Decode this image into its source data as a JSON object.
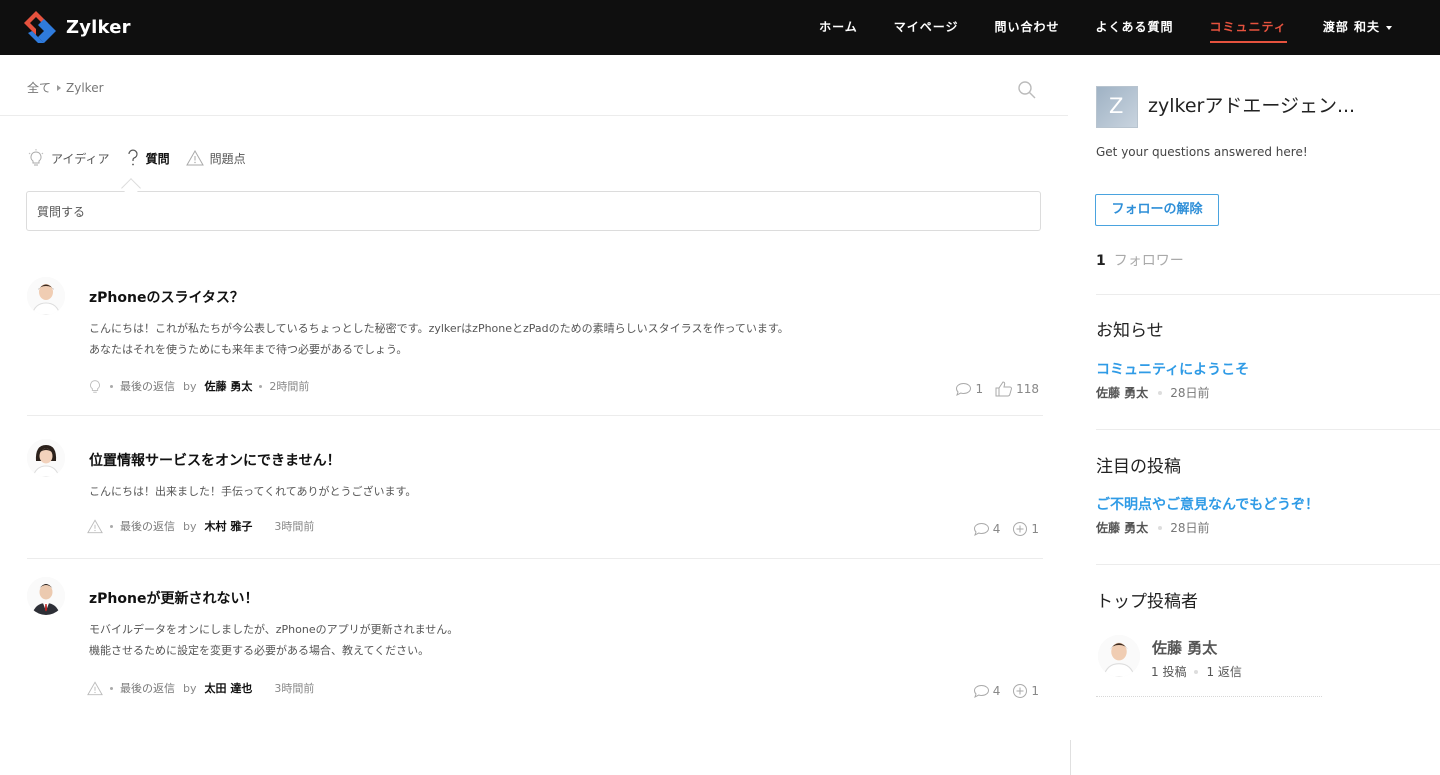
{
  "nav": {
    "brand": "Zylker",
    "items": [
      {
        "label": "ホーム",
        "active": false
      },
      {
        "label": "マイページ",
        "active": false
      },
      {
        "label": "問い合わせ",
        "active": false
      },
      {
        "label": "よくある質問",
        "active": false
      },
      {
        "label": "コミュニティ",
        "active": true
      },
      {
        "label": "渡部 和夫",
        "active": false,
        "dropdown": true
      }
    ],
    "accent_color": "#e5523e"
  },
  "breadcrumb": {
    "root": "全て",
    "current": "Zylker"
  },
  "tabs": [
    {
      "label": "アイディア",
      "icon": "lightbulb-icon",
      "active": false
    },
    {
      "label": "質問",
      "icon": "question-icon",
      "active": true
    },
    {
      "label": "問題点",
      "icon": "warning-icon",
      "active": false
    }
  ],
  "ask_box": {
    "placeholder": "質問する"
  },
  "posts": [
    {
      "title": "zPhoneのスライタス？",
      "body": [
        "こんにちは！これが私たちが今公表しているちょっとした秘密です。zylkerはzPhoneとzPadのための素晴らしいスタイラスを作っています。",
        "あなたはそれを使うためにも来年まで待つ必要があるでしょう。"
      ],
      "type_icon": "lightbulb-icon",
      "last_reply_label": "最後の返信",
      "by": "by",
      "author": "佐藤 勇太",
      "time": "2時間前",
      "comments": "1",
      "second_stat": "118",
      "second_stat_icon": "thumbs-up-icon"
    },
    {
      "title": "位置情報サービスをオンにできません！",
      "body": [
        "こんにちは！出来ました！手伝ってくれてありがとうございます。"
      ],
      "type_icon": "warning-icon",
      "last_reply_label": "最後の返信",
      "by": "by",
      "author": "木村 雅子",
      "time": "3時間前",
      "comments": "4",
      "second_stat": "1",
      "second_stat_icon": "plus-circle-icon"
    },
    {
      "title": "zPhoneが更新されない！",
      "body": [
        "モバイルデータをオンにしましたが、zPhoneのアプリが更新されません。",
        "機能させるために設定を変更する必要がある場合、教えてください。"
      ],
      "type_icon": "warning-icon",
      "last_reply_label": "最後の返信",
      "by": "by",
      "author": "太田 達也",
      "time": "3時間前",
      "comments": "4",
      "second_stat": "1",
      "second_stat_icon": "plus-circle-icon"
    }
  ],
  "sidebar": {
    "group_logo_letter": "Z",
    "group_name": "zylkerアドエージェン...",
    "group_desc": "Get your questions answered here!",
    "unfollow_label": "フォローの解除",
    "follower_count": "1",
    "follower_label": "フォロワー",
    "announcements": {
      "title": "お知らせ",
      "link": "コミュニティにようこそ",
      "author": "佐藤 勇太",
      "time": "28日前"
    },
    "featured": {
      "title": "注目の投稿",
      "link": "ご不明点やご意見なんでもどうぞ！",
      "author": "佐藤 勇太",
      "time": "28日前"
    },
    "top_posters": {
      "title": "トップ投稿者",
      "name": "佐藤 勇太",
      "posts": "1 投稿",
      "replies": "1 返信"
    },
    "link_color": "#2f9be6"
  }
}
